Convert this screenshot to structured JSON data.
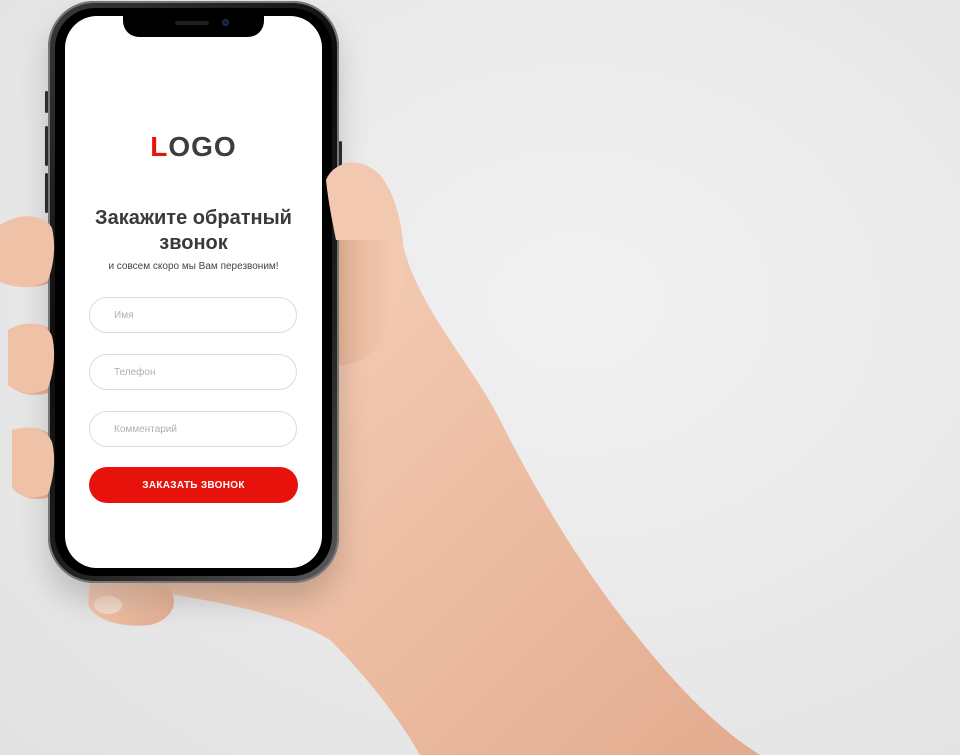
{
  "logo": {
    "first_letter": "L",
    "rest": "OGO"
  },
  "form": {
    "title": "Закажите обратный звонок",
    "subtitle": "и совсем скоро мы Вам перезвоним!",
    "name_placeholder": "Имя",
    "phone_placeholder": "Телефон",
    "comment_placeholder": "Комментарий",
    "submit_label": "ЗАКАЗАТЬ ЗВОНОК"
  },
  "colors": {
    "accent": "#e8120c",
    "text": "#3a3a3a",
    "background": "#e9e9ea"
  }
}
